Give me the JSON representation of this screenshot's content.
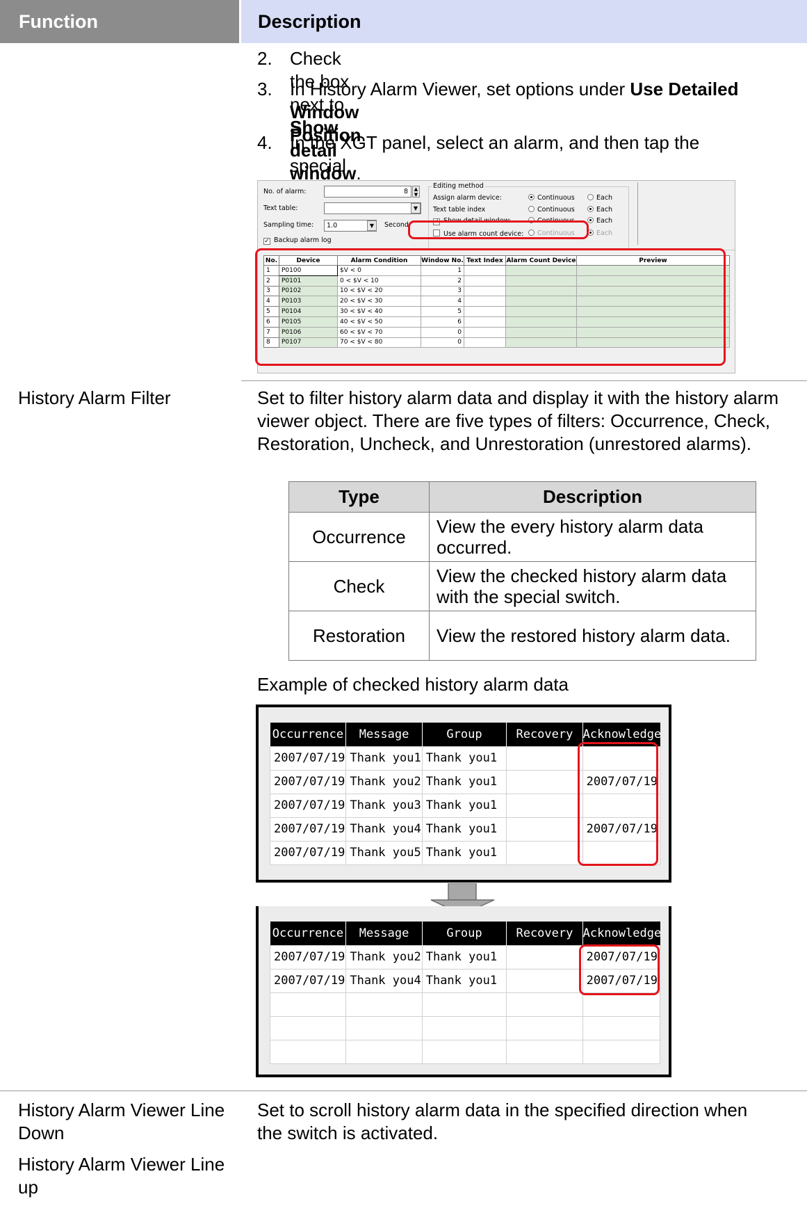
{
  "header": {
    "function": "Function",
    "description": "Description"
  },
  "steps": [
    {
      "num": "2.",
      "before": "Check the box next to ",
      "bold": "Show detail window",
      "after": "."
    },
    {
      "num": "3.",
      "line1_before": "In History Alarm Viewer, set options under ",
      "line1_bold": "Use Detailed",
      "line2_bold": "Window Position",
      "line2_after": "."
    },
    {
      "num": "4.",
      "line1": "In the XGT panel, select an alarm, and then tap the",
      "line2": "special switch."
    }
  ],
  "panel": {
    "no_of_alarm_label": "No. of alarm:",
    "no_of_alarm_value": "8",
    "text_table_label": "Text table:",
    "sampling_time_label": "Sampling time:",
    "sampling_time_value": "1.0",
    "sampling_unit": "Second",
    "backup_label": "Backup alarm log",
    "editing_method": "Editing method",
    "assign_device": "Assign alarm device:",
    "text_table_index": "Text table index",
    "show_detail": "Show detail window:",
    "use_alarm_count": "Use alarm count device:",
    "opt_continuous": "Continuous",
    "opt_each": "Each",
    "columns": [
      "No.",
      "Device",
      "Alarm Condition",
      "Window No.",
      "Text Index",
      "Alarm Count Device",
      "Preview"
    ],
    "rows": [
      {
        "no": "1",
        "device": "P0100",
        "condition": "$V < 0",
        "window": "1"
      },
      {
        "no": "2",
        "device": "P0101",
        "condition": "0 < $V < 10",
        "window": "2"
      },
      {
        "no": "3",
        "device": "P0102",
        "condition": "10 < $V < 20",
        "window": "3"
      },
      {
        "no": "4",
        "device": "P0103",
        "condition": "20 < $V < 30",
        "window": "4"
      },
      {
        "no": "5",
        "device": "P0104",
        "condition": "30 < $V < 40",
        "window": "5"
      },
      {
        "no": "6",
        "device": "P0105",
        "condition": "40 < $V < 50",
        "window": "6"
      },
      {
        "no": "7",
        "device": "P0106",
        "condition": "60 < $V < 70",
        "window": "0"
      },
      {
        "no": "8",
        "device": "P0107",
        "condition": "70 < $V < 80",
        "window": "0"
      }
    ]
  },
  "filter": {
    "function": "History Alarm Filter",
    "description": "Set to filter history alarm data and display it with the history alarm viewer object. There are five types of filters: Occurrence, Check, Restoration, Uncheck, and Unrestoration (unrestored alarms).",
    "table_headers": [
      "Type",
      "Description"
    ],
    "table_rows": [
      {
        "type": "Occurrence",
        "desc": "View the every history alarm data occurred."
      },
      {
        "type": "Check",
        "desc": "View the checked history alarm data with the special switch."
      },
      {
        "type": "Restoration",
        "desc": "View the restored history alarm data."
      }
    ],
    "example_caption": "Example of checked history alarm data"
  },
  "viewer": {
    "columns": [
      "Occurrence",
      "Message",
      "Group",
      "Recovery",
      "Acknowledge"
    ],
    "before_rows": [
      [
        "2007/07/19",
        "Thank you1",
        "Thank you1",
        "",
        ""
      ],
      [
        "2007/07/19",
        "Thank you2",
        "Thank you1",
        "",
        "2007/07/19"
      ],
      [
        "2007/07/19",
        "Thank you3",
        "Thank you1",
        "",
        ""
      ],
      [
        "2007/07/19",
        "Thank you4",
        "Thank you1",
        "",
        "2007/07/19"
      ],
      [
        "2007/07/19",
        "Thank you5",
        "Thank you1",
        "",
        ""
      ]
    ],
    "after_rows": [
      [
        "2007/07/19",
        "Thank you2",
        "Thank you1",
        "",
        "2007/07/19"
      ],
      [
        "2007/07/19",
        "Thank you4",
        "Thank you1",
        "",
        "2007/07/19"
      ],
      [
        "",
        "",
        "",
        "",
        ""
      ],
      [
        "",
        "",
        "",
        "",
        ""
      ],
      [
        "",
        "",
        "",
        "",
        ""
      ]
    ]
  },
  "line_row": {
    "function_1": "History Alarm Viewer Line Down",
    "function_2": "History Alarm Viewer Line up",
    "description": "Set to scroll history alarm data in the specified direction when the switch is activated."
  },
  "colors": {
    "accent_red": "#e4141c",
    "header_grey": "#8c8c8c",
    "header_blue": "#d6dcf6",
    "grid_green": "#dcebd9"
  }
}
